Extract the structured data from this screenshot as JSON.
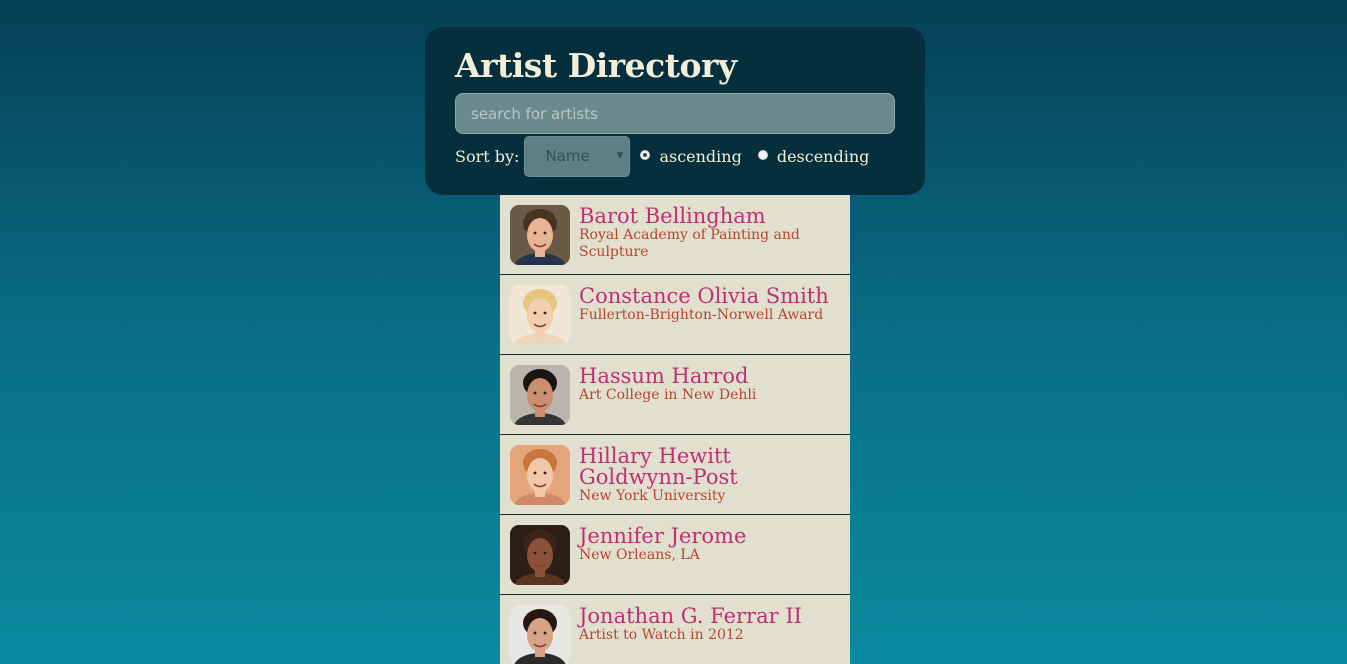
{
  "header": {
    "title": "Artist Directory",
    "search_placeholder": "search for artists",
    "search_value": "",
    "sort_label": "Sort by:",
    "sort_selected": "Name",
    "ascending_label": "ascending",
    "descending_label": "descending",
    "sort_order": "ascending"
  },
  "artists": [
    {
      "name": "Barot Bellingham",
      "school": "Royal Academy of Painting and Sculpture",
      "bg": "#6b5a46",
      "skin": "#e7b594",
      "hair": "#4a3122",
      "shirt": "#27344d"
    },
    {
      "name": "Constance Olivia Smith",
      "school": "Fullerton-Brighton-Norwell Award",
      "bg": "#efe6d6",
      "skin": "#f1cfae",
      "hair": "#e5c680",
      "shirt": "#ead6bb"
    },
    {
      "name": "Hassum Harrod",
      "school": "Art College in New Dehli",
      "bg": "#b8b6ae",
      "skin": "#c98f70",
      "hair": "#1c1410",
      "shirt": "#353535"
    },
    {
      "name": "Hillary Hewitt Goldwynn-Post",
      "school": "New York University",
      "bg": "#e6a47a",
      "skin": "#f2c8a8",
      "hair": "#c9763d",
      "shirt": "#cf8a63"
    },
    {
      "name": "Jennifer Jerome",
      "school": "New Orleans, LA",
      "bg": "#2a1e17",
      "skin": "#8a5236",
      "hair": "#3b2418",
      "shirt": "#5a3520"
    },
    {
      "name": "Jonathan G. Ferrar II",
      "school": "Artist to Watch in 2012",
      "bg": "#e6e6e4",
      "skin": "#d7a585",
      "hair": "#241812",
      "shirt": "#2a2a2a"
    }
  ],
  "colors": {
    "accent_name": "#bf2f74",
    "accent_school": "#b8442f",
    "panel": "#052f3c",
    "list_bg": "#e1e0cf"
  }
}
